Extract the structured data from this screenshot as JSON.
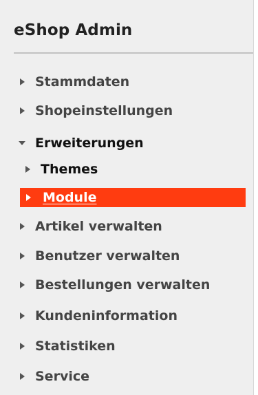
{
  "app": {
    "title": "eShop Admin"
  },
  "nav": {
    "items": [
      {
        "label": "Stammdaten",
        "state": "collapsed"
      },
      {
        "label": "Shopeinstellungen",
        "state": "collapsed"
      },
      {
        "label": "Erweiterungen",
        "state": "expanded",
        "children": [
          {
            "label": "Themes",
            "state": "collapsed"
          },
          {
            "label": "Module",
            "state": "active"
          }
        ]
      },
      {
        "label": "Artikel verwalten",
        "state": "collapsed"
      },
      {
        "label": "Benutzer verwalten",
        "state": "collapsed"
      },
      {
        "label": "Bestellungen verwalten",
        "state": "collapsed"
      },
      {
        "label": "Kundeninformation",
        "state": "collapsed"
      },
      {
        "label": "Statistiken",
        "state": "collapsed"
      },
      {
        "label": "Service",
        "state": "collapsed"
      }
    ]
  },
  "colors": {
    "active_background": "#ff3c10",
    "panel_background": "#efefef",
    "active_text": "#ffffff"
  },
  "icons": {
    "collapsed": "triangle-right-icon",
    "expanded": "triangle-down-icon"
  }
}
